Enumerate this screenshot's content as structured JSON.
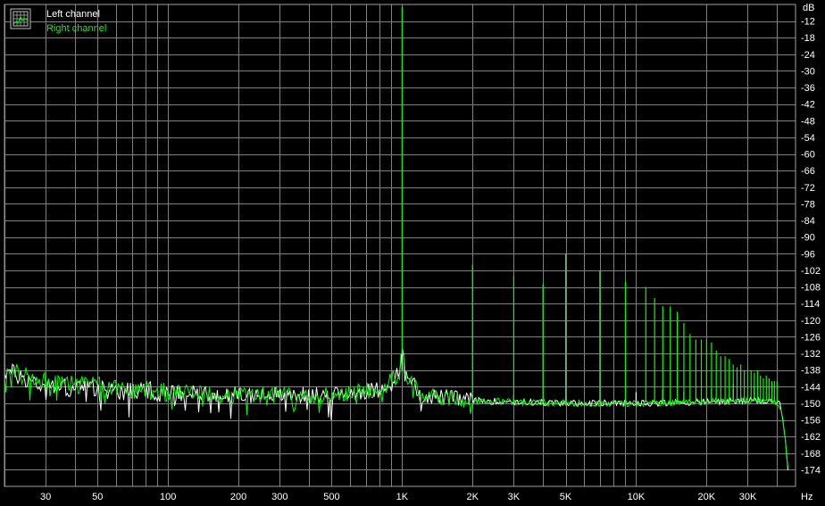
{
  "chart_data": {
    "type": "line",
    "title": "",
    "xlabel": "",
    "ylabel": "",
    "x_unit": "Hz",
    "y_unit": "dB",
    "xscale": "log",
    "xlim": [
      20,
      48000
    ],
    "ylim": [
      -180,
      -6
    ],
    "grid": true,
    "legend_position": "top-left",
    "background": "#000000",
    "grid_color": "#808080",
    "x_ticks": [
      {
        "value": 30,
        "label": "30"
      },
      {
        "value": 50,
        "label": "50"
      },
      {
        "value": 100,
        "label": "100"
      },
      {
        "value": 200,
        "label": "200"
      },
      {
        "value": 300,
        "label": "300"
      },
      {
        "value": 500,
        "label": "500"
      },
      {
        "value": 1000,
        "label": "1K"
      },
      {
        "value": 2000,
        "label": "2K"
      },
      {
        "value": 3000,
        "label": "3K"
      },
      {
        "value": 5000,
        "label": "5K"
      },
      {
        "value": 10000,
        "label": "10K"
      },
      {
        "value": 20000,
        "label": "20K"
      },
      {
        "value": 30000,
        "label": "30K"
      }
    ],
    "y_ticks": [
      -12,
      -18,
      -24,
      -30,
      -36,
      -42,
      -48,
      -54,
      -60,
      -66,
      -72,
      -78,
      -84,
      -90,
      -96,
      -102,
      -108,
      -114,
      -120,
      -126,
      -132,
      -138,
      -144,
      -150,
      -156,
      -162,
      -168,
      -174
    ],
    "series": [
      {
        "name": "Left channel",
        "color": "#ffffff",
        "noise_floor": [
          [
            20,
            -138
          ],
          [
            30,
            -144
          ],
          [
            50,
            -145
          ],
          [
            100,
            -146
          ],
          [
            200,
            -147
          ],
          [
            500,
            -147
          ],
          [
            800,
            -145
          ],
          [
            950,
            -140
          ],
          [
            1000,
            -132
          ],
          [
            1050,
            -140
          ],
          [
            1200,
            -147
          ],
          [
            2000,
            -149
          ],
          [
            5000,
            -150
          ],
          [
            10000,
            -150
          ],
          [
            20000,
            -149.5
          ],
          [
            38000,
            -149
          ],
          [
            41000,
            -150
          ],
          [
            43000,
            -160
          ],
          [
            45000,
            -178
          ]
        ],
        "peaks": [
          [
            1000,
            -138
          ],
          [
            2000,
            -148
          ],
          [
            3000,
            -147
          ],
          [
            5000,
            -148
          ],
          [
            10000,
            -146
          ],
          [
            13000,
            -145
          ],
          [
            16000,
            -146
          ],
          [
            21000,
            -145
          ],
          [
            26000,
            -143
          ],
          [
            32000,
            -144
          ]
        ]
      },
      {
        "name": "Right channel",
        "color": "#00ff00",
        "noise_floor": [
          [
            20,
            -138
          ],
          [
            30,
            -142
          ],
          [
            50,
            -144
          ],
          [
            100,
            -146
          ],
          [
            200,
            -147
          ],
          [
            500,
            -147
          ],
          [
            800,
            -145
          ],
          [
            950,
            -140
          ],
          [
            1000,
            -132
          ],
          [
            1050,
            -140
          ],
          [
            1200,
            -147
          ],
          [
            2000,
            -149
          ],
          [
            5000,
            -150
          ],
          [
            10000,
            -150
          ],
          [
            20000,
            -149.5
          ],
          [
            38000,
            -149
          ],
          [
            41000,
            -150
          ],
          [
            43000,
            -160
          ],
          [
            45000,
            -178
          ]
        ],
        "peaks": [
          [
            1000,
            -7
          ],
          [
            2000,
            -100
          ],
          [
            3000,
            -104
          ],
          [
            4000,
            -107
          ],
          [
            5000,
            -96
          ],
          [
            7000,
            -102
          ],
          [
            9000,
            -106
          ],
          [
            11000,
            -108
          ],
          [
            12000,
            -112
          ],
          [
            13000,
            -115
          ],
          [
            14000,
            -115
          ],
          [
            15000,
            -117
          ],
          [
            16000,
            -121
          ],
          [
            17000,
            -125
          ],
          [
            18000,
            -127
          ],
          [
            19000,
            -127
          ],
          [
            20000,
            -127
          ],
          [
            21000,
            -128
          ],
          [
            22000,
            -131
          ],
          [
            23000,
            -133
          ],
          [
            24000,
            -133
          ],
          [
            25000,
            -134
          ],
          [
            26000,
            -136
          ],
          [
            27000,
            -137
          ],
          [
            28000,
            -136
          ],
          [
            29000,
            -138
          ],
          [
            30000,
            -138
          ],
          [
            31000,
            -138
          ],
          [
            32000,
            -139
          ],
          [
            33000,
            -138
          ],
          [
            34000,
            -140
          ],
          [
            35000,
            -141
          ],
          [
            36000,
            -140
          ],
          [
            37000,
            -141
          ],
          [
            38000,
            -142
          ],
          [
            39000,
            -142
          ],
          [
            40000,
            -142
          ]
        ]
      }
    ]
  }
}
